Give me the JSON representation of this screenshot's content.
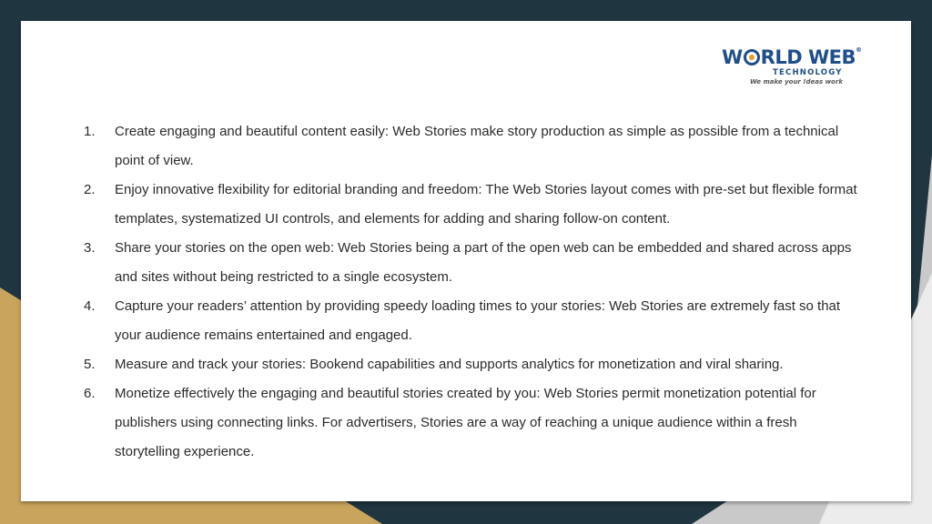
{
  "logo": {
    "main": "WORLD WEB",
    "main_pre": "W",
    "main_post": "RLD WEB",
    "trademark": "®",
    "sub": "TECHNOLOGY",
    "tagline": "We make your !deas work"
  },
  "items": [
    {
      "num": "1.",
      "text": "Create engaging and beautiful content easily: Web Stories make story production as simple as possible from a technical point of view."
    },
    {
      "num": "2.",
      "text": "Enjoy innovative flexibility for editorial branding and freedom: The Web Stories layout comes with pre-set but flexible format templates, systematized UI controls, and elements for adding and sharing follow-on content."
    },
    {
      "num": "3.",
      "text": "Share your stories on the open web: Web Stories being a part of the open web can be embedded and shared across apps and sites without being restricted to a single ecosystem."
    },
    {
      "num": "4.",
      "text": "Capture your readers’ attention by providing speedy loading times to your stories: Web Stories are extremely fast so that your audience remains entertained and engaged."
    },
    {
      "num": "5.",
      "text": "Measure and track your stories: Bookend capabilities and supports analytics for monetization and viral sharing."
    },
    {
      "num": "6.",
      "text": "Monetize effectively the engaging and beautiful stories created by you: Web Stories permit monetization potential for publishers using connecting links. For advertisers, Stories are a way of reaching a unique audience within a fresh storytelling experience."
    }
  ],
  "colors": {
    "background_dark": "#1f3540",
    "accent_gold": "#c9a45c",
    "logo_blue": "#1f4e8a",
    "logo_orange": "#e0a22b"
  }
}
